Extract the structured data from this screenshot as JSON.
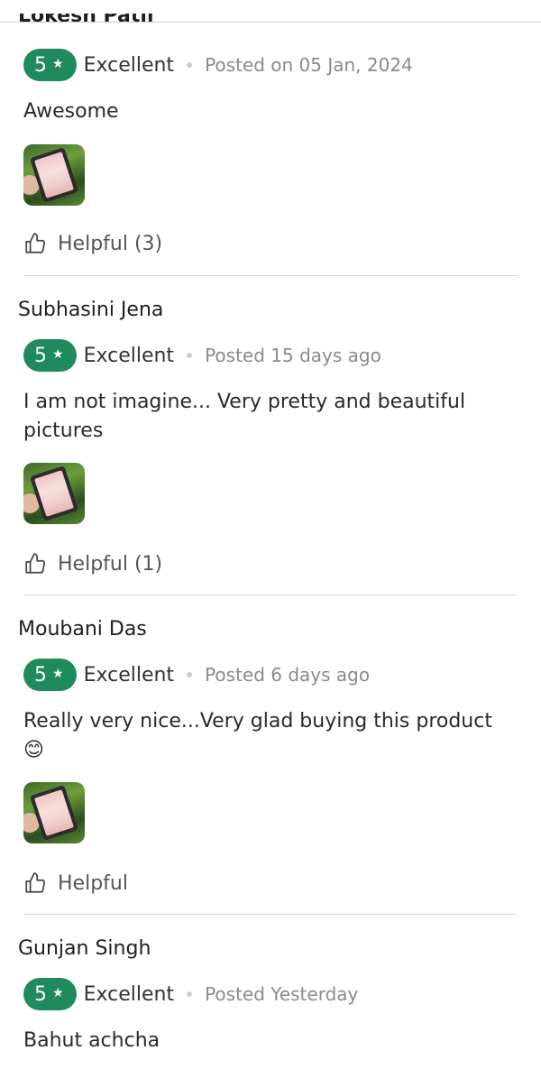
{
  "partial_reviewer": {
    "name": "Lokesh Patil"
  },
  "reviews": [
    {
      "rating": "5",
      "rating_label": "Excellent",
      "posted": "Posted on 05 Jan, 2024",
      "text": "Awesome",
      "helpful": "Helpful (3)"
    },
    {
      "name": "Subhasini Jena",
      "rating": "5",
      "rating_label": "Excellent",
      "posted": "Posted 15 days ago",
      "text": "I am not imagine... Very pretty and beautiful pictures",
      "helpful": "Helpful (1)"
    },
    {
      "name": "Moubani Das",
      "rating": "5",
      "rating_label": "Excellent",
      "posted": "Posted 6 days ago",
      "text": "Really very nice...Very glad buying this product 😊",
      "helpful": "Helpful"
    },
    {
      "name": "Gunjan Singh",
      "rating": "5",
      "rating_label": "Excellent",
      "posted": "Posted Yesterday",
      "text": "Bahut achcha"
    }
  ],
  "icons": {
    "star": "star-icon",
    "helpful": "thumbs-up-icon"
  },
  "colors": {
    "rating_badge": "#1f8a5b"
  }
}
